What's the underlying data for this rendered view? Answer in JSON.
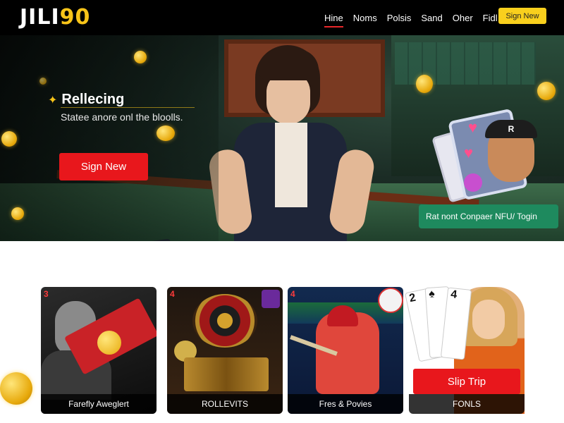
{
  "header": {
    "logo_white": "JILI",
    "logo_yellow": "90",
    "nav": [
      {
        "label": "Hine",
        "active": true
      },
      {
        "label": "Noms"
      },
      {
        "label": "Polsis"
      },
      {
        "label": "Sand"
      },
      {
        "label": "Oher"
      },
      {
        "label": "Fidl"
      }
    ],
    "signup_label": "Sign New"
  },
  "hero": {
    "title": "Rellecing",
    "subtitle": "Statee anore onl the bloolls.",
    "cta_label": "Sign New",
    "green_button_label": "Rat nont  Conpaer NFU/  Togin",
    "avatar_cap_letter": "R"
  },
  "games": [
    {
      "badge": "3",
      "label": "Farefly Aweglert"
    },
    {
      "badge": "4",
      "label": "ROLLEVITS"
    },
    {
      "badge": "4",
      "label": "Fres & Povies"
    },
    {
      "badge": "",
      "label": "FONLS",
      "button_label": "Slip Trip",
      "card_ranks": [
        "2",
        "♠",
        "4"
      ]
    }
  ],
  "colors": {
    "accent_red": "#e8171c",
    "accent_yellow": "#f9d01d",
    "accent_green": "#1e8a5e",
    "header_bg": "#000000"
  },
  "icons": {
    "spark": "sparkle-icon",
    "coin": "gold-coin-icon"
  }
}
